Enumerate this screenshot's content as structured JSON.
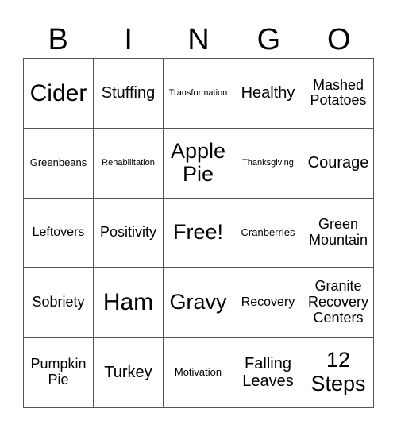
{
  "header": [
    "B",
    "I",
    "N",
    "G",
    "O"
  ],
  "cells": [
    "Cider",
    "Stuffing",
    "Transformation",
    "Healthy",
    "Mashed Potatoes",
    "Greenbeans",
    "Rehabilitation",
    "Apple Pie",
    "Thanksgiving",
    "Courage",
    "Leftovers",
    "Positivity",
    "Free!",
    "Cranberries",
    "Green Mountain",
    "Sobriety",
    "Ham",
    "Gravy",
    "Recovery",
    "Granite Recovery Centers",
    "Pumpkin Pie",
    "Turkey",
    "Motivation",
    "Falling Leaves",
    "12 Steps"
  ]
}
